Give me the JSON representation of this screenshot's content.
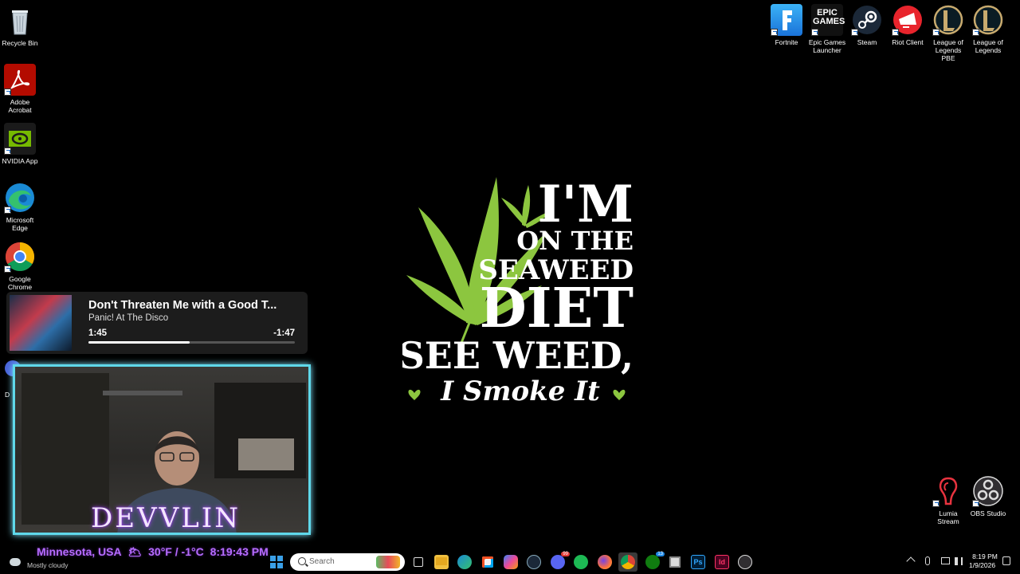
{
  "desktop": {
    "icons_left": [
      {
        "label": "Recycle Bin",
        "icon": "recycle-bin-icon"
      },
      {
        "label": "Adobe Acrobat",
        "icon": "adobe-acrobat-icon"
      },
      {
        "label": "NVIDIA App",
        "icon": "nvidia-icon"
      },
      {
        "label": "Microsoft Edge",
        "icon": "edge-icon"
      },
      {
        "label": "Google Chrome",
        "icon": "chrome-icon"
      }
    ],
    "icons_top_right": [
      {
        "label": "Fortnite",
        "icon": "fortnite-icon"
      },
      {
        "label": "Epic Games Launcher",
        "icon": "epic-games-icon"
      },
      {
        "label": "Steam",
        "icon": "steam-icon"
      },
      {
        "label": "Riot Client",
        "icon": "riot-client-icon"
      },
      {
        "label": "League of Legends PBE",
        "icon": "league-pbe-icon"
      },
      {
        "label": "League of Legends",
        "icon": "league-icon"
      }
    ],
    "icons_bottom_right": [
      {
        "label": "Lumia Stream",
        "icon": "lumia-stream-icon"
      },
      {
        "label": "OBS Studio",
        "icon": "obs-icon"
      }
    ],
    "partial_icon_label": "D",
    "epic_logo_text": "EPIC GAMES"
  },
  "wallpaper": {
    "line1": "I'M",
    "line2": "ON THE",
    "line3": "SEAWEED",
    "line4": "DIET",
    "line5": "I SEE WEED,",
    "line6": "I Smoke It",
    "accent": "#8cc63f"
  },
  "media": {
    "title": "Don't Threaten Me with a Good T...",
    "artist": "Panic! At The Disco",
    "elapsed": "1:45",
    "remaining": "-1:47",
    "progress": 0.49
  },
  "overlay": {
    "channel": "DEVVLIN",
    "location": "Minnesota, USA",
    "weather_icon": "🌥",
    "temperature": "30°F / -1°C",
    "clock": "8:19:43 PM"
  },
  "taskbar": {
    "weather_text": "Mostly cloudy",
    "search_placeholder": "Search",
    "apps": [
      "task-view-icon",
      "file-explorer-icon",
      "edge-icon",
      "store-icon",
      "copilot-icon",
      "steam-icon",
      "discord-icon",
      "spotify-icon",
      "firefox-icon",
      "chrome-icon",
      "xbox-icon",
      "app-icon",
      "photoshop-icon",
      "indesign-icon",
      "obs-icon"
    ],
    "discord_badge": "99",
    "xbox_badge": "13",
    "time": "8:19 PM",
    "date": "1/9/2026"
  }
}
